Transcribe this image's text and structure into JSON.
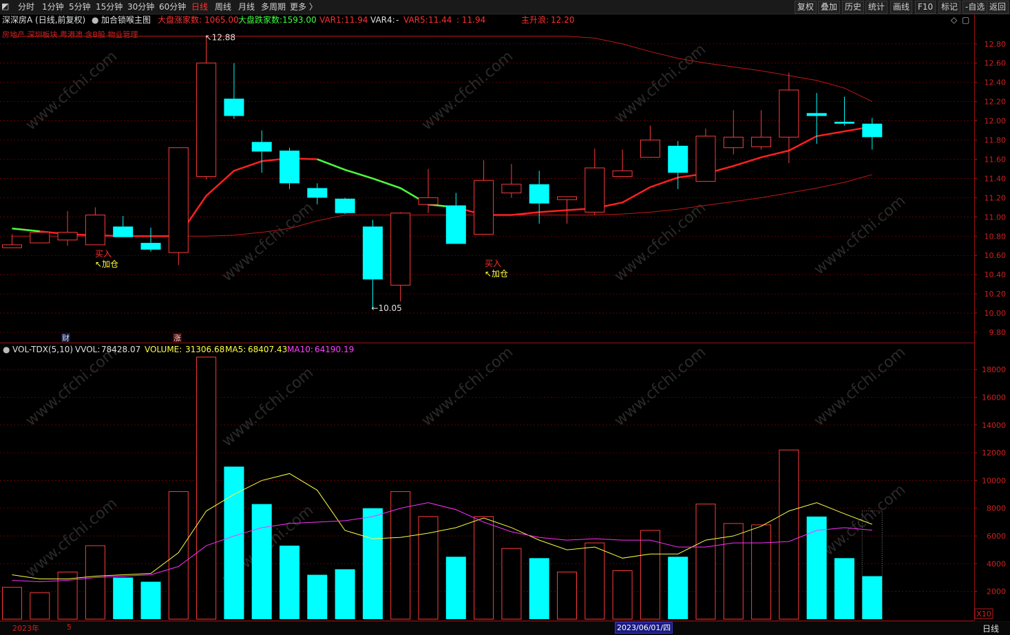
{
  "toolbar": {
    "periods": [
      "分时",
      "1分钟",
      "5分钟",
      "15分钟",
      "30分钟",
      "60分钟",
      "日线",
      "周线",
      "月线",
      "多周期",
      "更多 〉"
    ],
    "active_period": "日线",
    "right_buttons": [
      "复权",
      "叠加",
      "历史",
      "统计",
      "画线",
      "F10",
      "标记",
      "-自选",
      "返回"
    ]
  },
  "info": {
    "stock": "深深房A (日线,前复权)",
    "indicator": "加合锁喉主图",
    "up_count_label": "大盘涨家数:",
    "up_count_value": "1065.00",
    "down_count_label": "大盘跌家数:",
    "down_count_value": "1593.00",
    "var1_label": "VAR1:",
    "var1_value": "11.94",
    "var4_label": "VAR4:",
    "var4_value": "-",
    "var5_label": "VAR5:",
    "var5_value": "11.44",
    "extra_value": ": 11.94",
    "main_up_label": "主升浪:",
    "main_up_value": "12.20"
  },
  "sectors": "房地产 深圳板块 粤港澳 含B股 物业管理",
  "volume_info": {
    "name": "VOL-TDX(5,10)",
    "vvol_label": "VVOL:",
    "vvol_value": "78428.07",
    "volume_label": "VOLUME:",
    "volume_value": "31306.68",
    "ma5_label": "MA5:",
    "ma5_value": "68407.43",
    "ma10_label": "MA10:",
    "ma10_value": "64190.19"
  },
  "annotations": {
    "high_label": "12.88",
    "low_label": "10.05",
    "buy1": "买入",
    "add1": "↖加仓",
    "buy2": "买入",
    "add2": "↖加仓",
    "finance_marker": "财",
    "rise_marker": "涨",
    "scale_label": "X10"
  },
  "status": {
    "year_label": "2023年",
    "month_label": "5",
    "date_cursor": "2023/06/01/四",
    "period_label": "日线"
  },
  "watermark": "www.cfchi.com",
  "colors": {
    "up": "#ff3b3b",
    "down": "#00ffff",
    "ma_red": "#ff2020",
    "ma_green": "#40ff40",
    "band": "#c01818",
    "vol_ma5": "#ffff40",
    "vol_ma10": "#ff30ff"
  },
  "chart_data": [
    {
      "type": "candlestick",
      "title": "深深房A (日线,前复权)",
      "y_ticks": [
        9.8,
        10.0,
        10.2,
        10.4,
        10.6,
        10.8,
        11.0,
        11.2,
        11.4,
        11.6,
        11.8,
        12.0,
        12.2,
        12.4,
        12.6,
        12.8
      ],
      "ylim": [
        9.7,
        12.97
      ],
      "candles": [
        {
          "o": 10.68,
          "h": 10.82,
          "l": 10.68,
          "c": 10.71
        },
        {
          "o": 10.73,
          "h": 10.85,
          "l": 10.73,
          "c": 10.84
        },
        {
          "o": 10.76,
          "h": 11.06,
          "l": 10.7,
          "c": 10.84
        },
        {
          "o": 10.71,
          "h": 11.1,
          "l": 10.71,
          "c": 11.02
        },
        {
          "o": 10.9,
          "h": 11.01,
          "l": 10.8,
          "c": 10.79
        },
        {
          "o": 10.73,
          "h": 10.89,
          "l": 10.64,
          "c": 10.66
        },
        {
          "o": 10.63,
          "h": 11.72,
          "l": 10.5,
          "c": 11.72
        },
        {
          "o": 11.42,
          "h": 12.88,
          "l": 11.39,
          "c": 12.6
        },
        {
          "o": 12.23,
          "h": 12.6,
          "l": 12.02,
          "c": 12.05
        },
        {
          "o": 11.78,
          "h": 11.9,
          "l": 11.46,
          "c": 11.68
        },
        {
          "o": 11.69,
          "h": 11.72,
          "l": 11.29,
          "c": 11.35
        },
        {
          "o": 11.3,
          "h": 11.35,
          "l": 11.13,
          "c": 11.2
        },
        {
          "o": 11.19,
          "h": 11.2,
          "l": 11.03,
          "c": 11.04
        },
        {
          "o": 10.9,
          "h": 10.97,
          "l": 10.05,
          "c": 10.35
        },
        {
          "o": 10.29,
          "h": 11.05,
          "l": 10.12,
          "c": 11.04
        },
        {
          "o": 11.13,
          "h": 11.5,
          "l": 11.04,
          "c": 11.2
        },
        {
          "o": 11.12,
          "h": 11.25,
          "l": 10.9,
          "c": 10.72
        },
        {
          "o": 10.82,
          "h": 11.59,
          "l": 10.82,
          "c": 11.38
        },
        {
          "o": 11.25,
          "h": 11.55,
          "l": 11.2,
          "c": 11.34
        },
        {
          "o": 11.34,
          "h": 11.48,
          "l": 10.93,
          "c": 11.14
        },
        {
          "o": 11.18,
          "h": 11.21,
          "l": 10.93,
          "c": 11.21
        },
        {
          "o": 11.05,
          "h": 11.71,
          "l": 11.02,
          "c": 11.51
        },
        {
          "o": 11.42,
          "h": 11.7,
          "l": 11.42,
          "c": 11.48
        },
        {
          "o": 11.62,
          "h": 11.95,
          "l": 11.62,
          "c": 11.8
        },
        {
          "o": 11.74,
          "h": 11.79,
          "l": 11.29,
          "c": 11.46
        },
        {
          "o": 11.37,
          "h": 11.92,
          "l": 11.37,
          "c": 11.84
        },
        {
          "o": 11.72,
          "h": 12.11,
          "l": 11.65,
          "c": 11.83
        },
        {
          "o": 11.73,
          "h": 12.11,
          "l": 11.7,
          "c": 11.83
        },
        {
          "o": 11.83,
          "h": 12.5,
          "l": 11.56,
          "c": 12.32
        },
        {
          "o": 12.08,
          "h": 12.29,
          "l": 11.76,
          "c": 12.05
        },
        {
          "o": 11.99,
          "h": 12.25,
          "l": 11.95,
          "c": 11.97
        },
        {
          "o": 11.97,
          "h": 12.03,
          "l": 11.7,
          "c": 11.83
        }
      ],
      "ma_line": [
        10.88,
        10.85,
        10.82,
        10.81,
        10.8,
        10.8,
        10.8,
        11.22,
        11.48,
        11.58,
        11.61,
        11.6,
        11.49,
        11.4,
        11.3,
        11.13,
        11.1,
        11.02,
        11.02,
        11.05,
        11.07,
        11.09,
        11.15,
        11.31,
        11.41,
        11.45,
        11.53,
        11.62,
        11.69,
        11.84,
        11.89,
        11.94
      ],
      "ma_line_green_segments": [
        [
          0,
          1
        ],
        [
          11,
          16
        ]
      ],
      "upper_band": [
        12.88,
        12.88,
        12.88,
        12.88,
        12.88,
        12.88,
        12.88,
        12.88,
        12.88,
        12.88,
        12.88,
        12.88,
        12.88,
        12.88,
        12.88,
        12.88,
        12.88,
        12.88,
        12.88,
        12.88,
        12.88,
        12.86,
        12.8,
        12.72,
        12.65,
        12.6,
        12.56,
        12.52,
        12.47,
        12.42,
        12.34,
        12.2
      ],
      "lower_band": [
        10.8,
        10.8,
        10.8,
        10.8,
        10.8,
        10.8,
        10.8,
        10.8,
        10.81,
        10.84,
        10.88,
        10.96,
        11.02,
        11.02,
        11.02,
        11.02,
        11.02,
        11.02,
        11.02,
        11.02,
        11.02,
        11.02,
        11.03,
        11.05,
        11.08,
        11.12,
        11.16,
        11.2,
        11.25,
        11.3,
        11.36,
        11.44
      ]
    },
    {
      "type": "bar",
      "title": "VOL-TDX(5,10)",
      "y_ticks": [
        2000,
        4000,
        6000,
        8000,
        10000,
        12000,
        14000,
        16000,
        18000
      ],
      "ylim": [
        0,
        19000
      ],
      "volumes": [
        2300,
        1900,
        3400,
        5300,
        3000,
        2700,
        9200,
        18900,
        11000,
        8300,
        5300,
        3200,
        3600,
        8000,
        9200,
        7400,
        4500,
        7400,
        5100,
        4400,
        3400,
        5500,
        3500,
        6400,
        4500,
        8300,
        6900,
        6800,
        12200,
        7400,
        4400,
        3100
      ],
      "last_bar_ghost": 7800,
      "ma5": [
        3200,
        2900,
        2900,
        3100,
        3200,
        3300,
        4800,
        7800,
        9000,
        10000,
        10500,
        9300,
        6400,
        5800,
        5900,
        6200,
        6600,
        7300,
        6600,
        5700,
        5000,
        5200,
        4400,
        4700,
        4700,
        5700,
        6000,
        6700,
        7800,
        8400,
        7600,
        6840
      ],
      "ma10": [
        2800,
        2700,
        2800,
        3000,
        3100,
        3200,
        3800,
        5300,
        6000,
        6600,
        6900,
        7000,
        7100,
        7400,
        8000,
        8400,
        7900,
        7000,
        6300,
        5900,
        5700,
        5800,
        5700,
        5700,
        5200,
        5200,
        5500,
        5500,
        5600,
        6400,
        6600,
        6420
      ]
    }
  ]
}
